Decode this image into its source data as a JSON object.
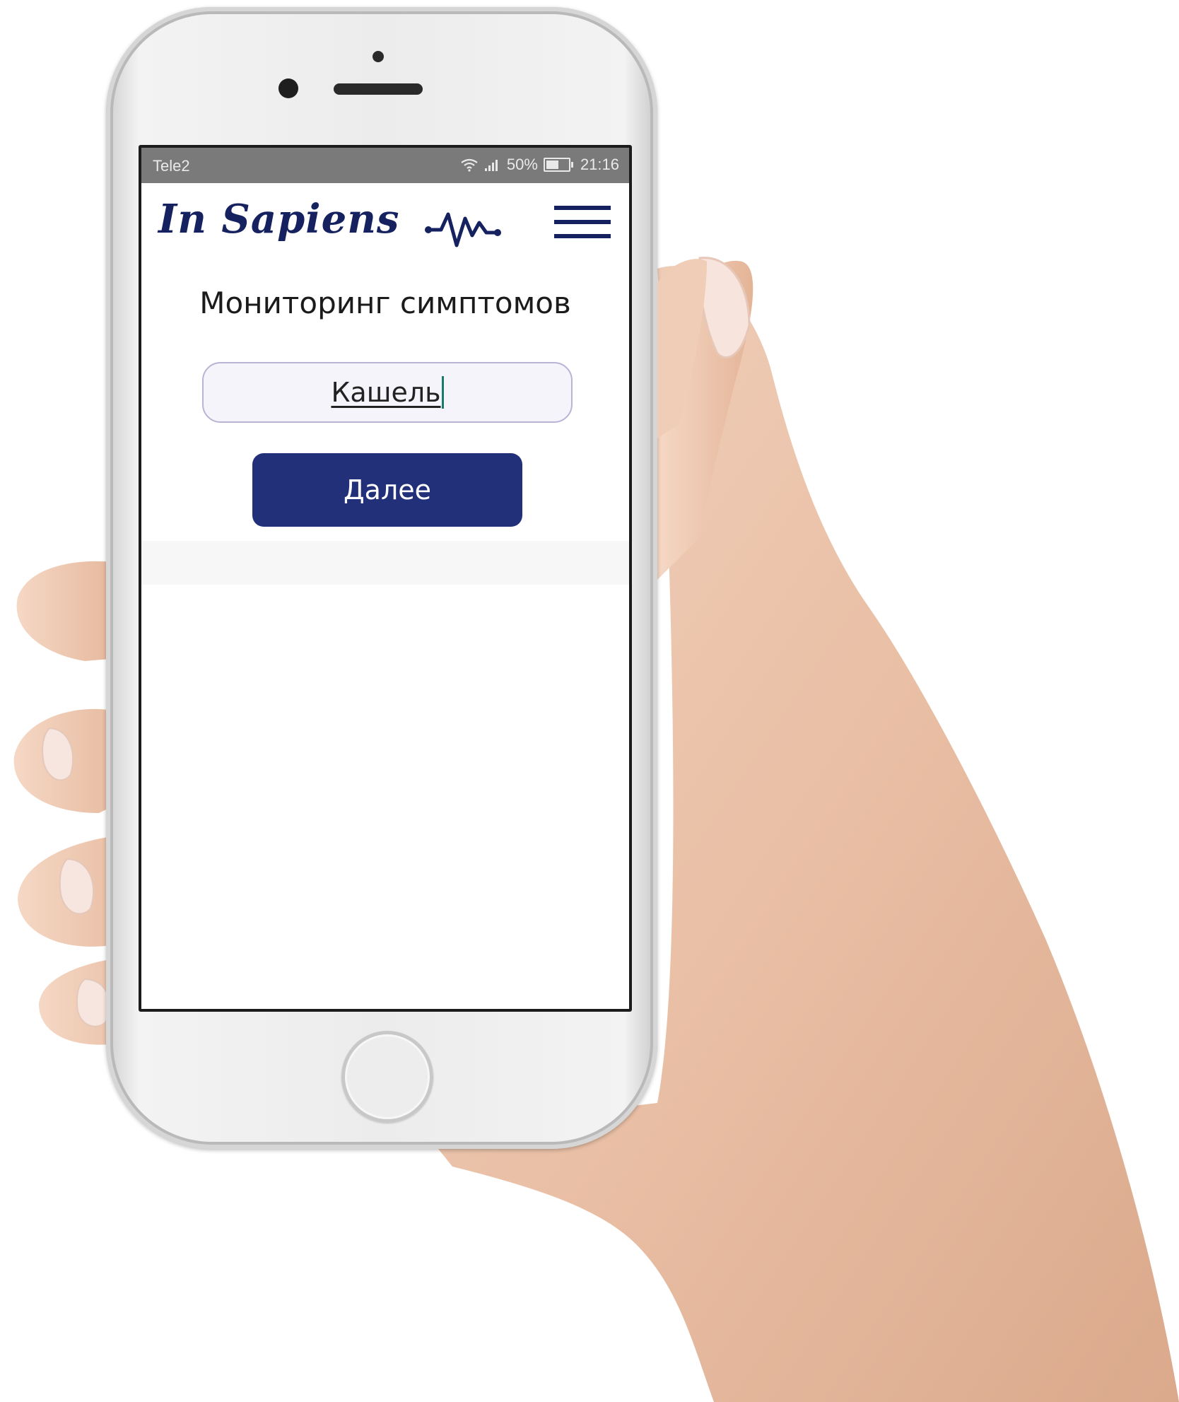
{
  "status_bar": {
    "carrier": "Tele2",
    "battery": "50%",
    "time": "21:16"
  },
  "header": {
    "logo": "In Sapiens",
    "pulse_icon": "heart-rate-icon",
    "menu_icon": "hamburger-menu-icon"
  },
  "main": {
    "title": "Мониторинг симптомов",
    "symptom_input": {
      "value": "Кашель"
    },
    "next_button": "Далее"
  },
  "colors": {
    "brand": "#15225f",
    "button": "#22307a",
    "input_border": "#b8b4d6",
    "caret": "#1b7a6a"
  }
}
